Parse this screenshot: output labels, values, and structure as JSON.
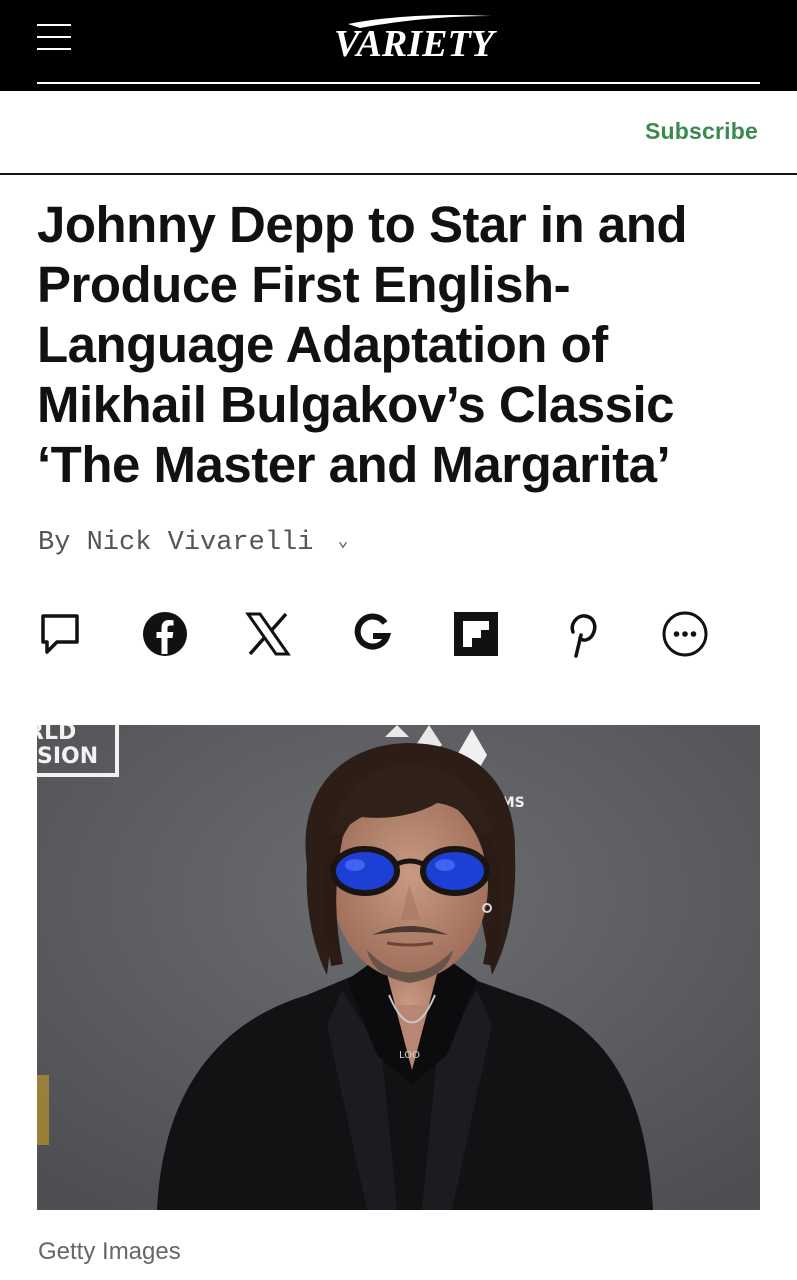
{
  "header": {
    "logo_text": "VARIETY",
    "subscribe_label": "Subscribe",
    "accent_color": "#3b8a4d"
  },
  "article": {
    "headline": "Johnny Depp to Star in and Produce First English-Language Adaptation of Mikhail Bulgakov’s Classic ‘The Master and Margarita’",
    "byline_prefix": "By",
    "author": "Nick Vivarelli",
    "photo_credit": "Getty Images"
  },
  "share_icons": [
    "comment-icon",
    "facebook-icon",
    "x-icon",
    "google-icon",
    "flipboard-icon",
    "pinterest-icon",
    "more-icon"
  ],
  "photo": {
    "backdrop_text_1": "RLD",
    "backdrop_text_2": "SION",
    "backdrop_text_3": "FILMS",
    "pendant_text": "LOO"
  }
}
